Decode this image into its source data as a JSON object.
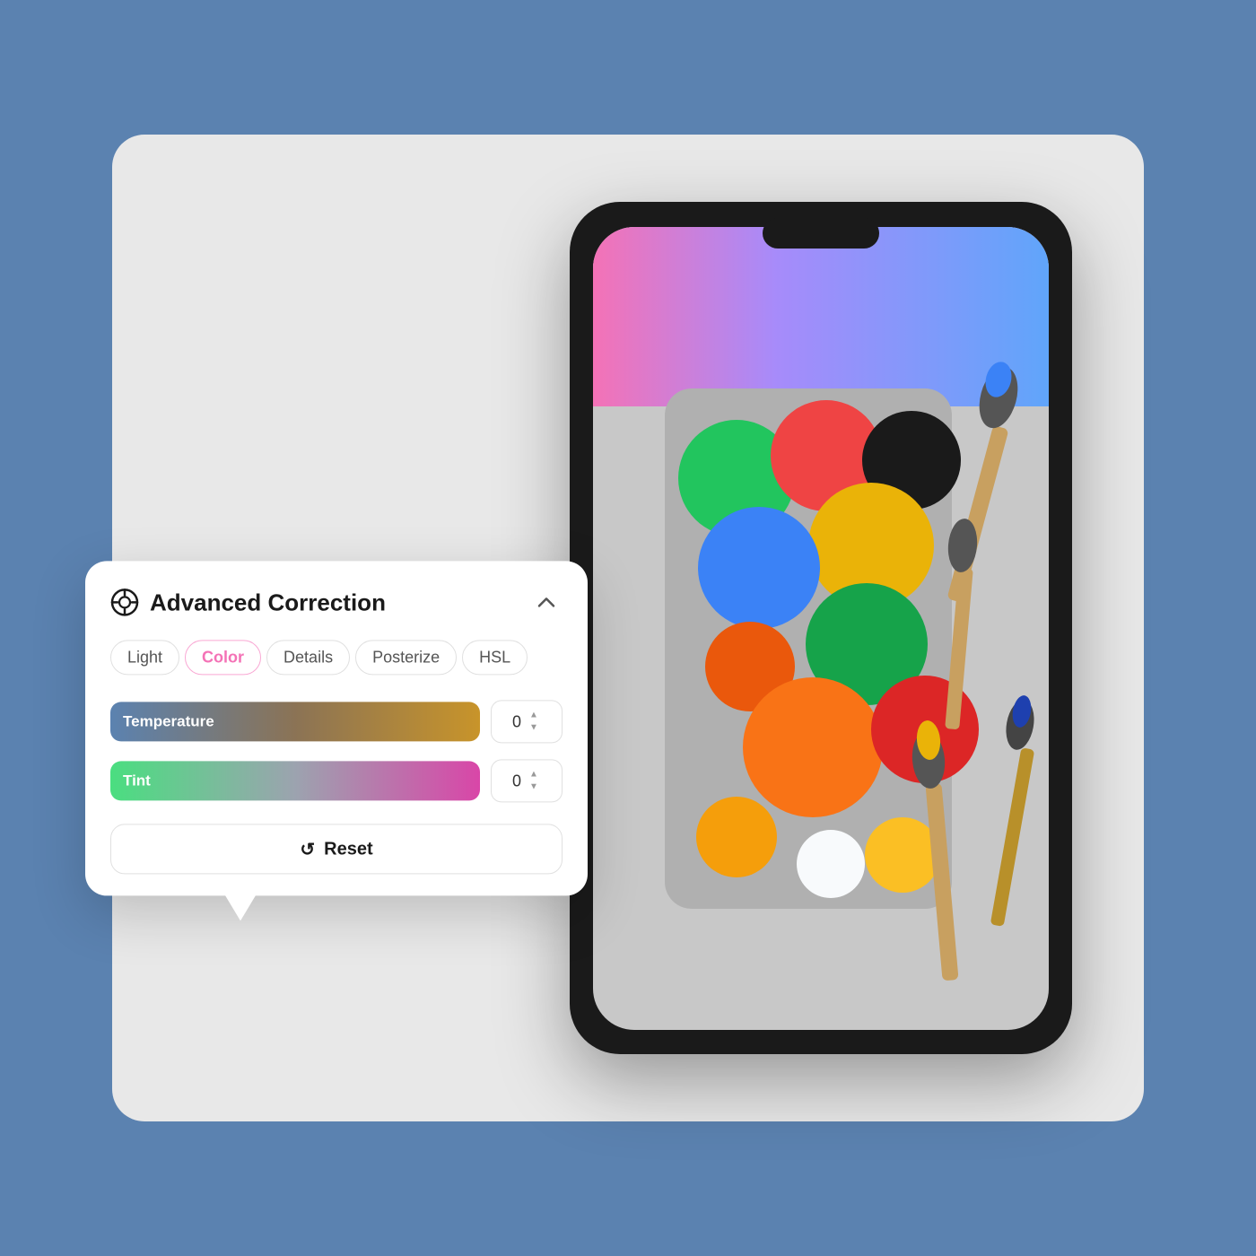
{
  "background": {
    "color": "#5b82b0"
  },
  "card": {
    "bg": "#e8e8e8"
  },
  "popup": {
    "title": "Advanced Correction",
    "collapse_label": "^",
    "tabs": [
      {
        "id": "light",
        "label": "Light",
        "active": false
      },
      {
        "id": "color",
        "label": "Color",
        "active": true
      },
      {
        "id": "details",
        "label": "Details",
        "active": false
      },
      {
        "id": "posterize",
        "label": "Posterize",
        "active": false
      },
      {
        "id": "hsl",
        "label": "HSL",
        "active": false
      }
    ],
    "sliders": [
      {
        "id": "temperature",
        "label": "Temperature",
        "value": "0",
        "gradient_start": "#5b82b0",
        "gradient_mid": "#8b7355",
        "gradient_end": "#c8942a"
      },
      {
        "id": "tint",
        "label": "Tint",
        "value": "0",
        "gradient_start": "#4ade80",
        "gradient_mid": "#9ca3af",
        "gradient_end": "#d946a8"
      }
    ],
    "reset_button": "Reset"
  },
  "phone": {
    "has_notch": true
  }
}
